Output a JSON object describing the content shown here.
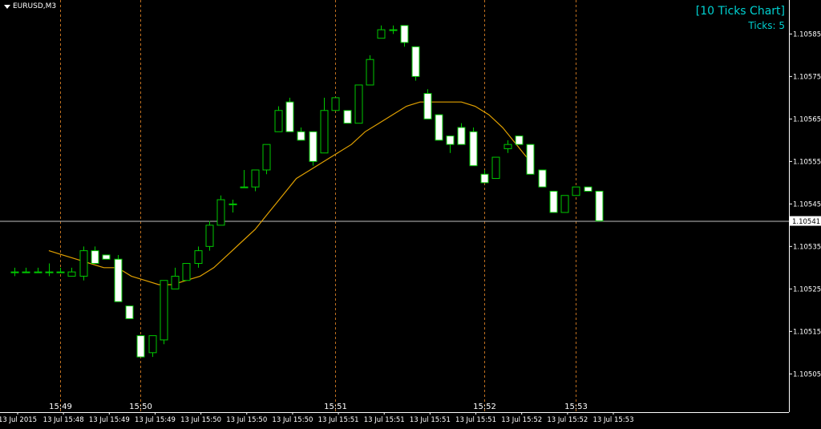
{
  "header": {
    "symbol": "EURUSD,M3",
    "dropdown_icon": "triangle-down-icon"
  },
  "indicator": {
    "title": "[10 Ticks Chart]",
    "ticks_label": "Ticks: 5"
  },
  "colors": {
    "background": "#000000",
    "bull_fill": "#000000",
    "bull_stroke": "#00c800",
    "bear_fill": "#ffffff",
    "bear_stroke": "#00c800",
    "ma_line": "#e0a000",
    "grid": "#c07020",
    "axis": "#ffffff",
    "info_text": "#00d0d0"
  },
  "chart_data": {
    "type": "candlestick",
    "title": "",
    "ylim": [
      1.10496,
      1.10593
    ],
    "y_ticks": [
      "1.10585",
      "1.10575",
      "1.10565",
      "1.10555",
      "1.10545",
      "1.10535",
      "1.10525",
      "1.10515",
      "1.10505"
    ],
    "current_price": "1.10541",
    "x_major_labels": [
      "15:49",
      "15:50",
      "15:51",
      "15:52",
      "15:53"
    ],
    "x_date_labels": [
      "13 Jul 2015",
      "13 Jul 15:48",
      "13 Jul 15:49",
      "13 Jul 15:49",
      "13 Jul 15:50",
      "13 Jul 15:50",
      "13 Jul 15:50",
      "13 Jul 15:51",
      "13 Jul 15:51",
      "13 Jul 15:51",
      "13 Jul 15:51",
      "13 Jul 15:52",
      "13 Jul 15:52",
      "13 Jul 15:53"
    ],
    "candles": [
      {
        "o": 1.10529,
        "h": 1.1053,
        "l": 1.10528,
        "c": 1.10529
      },
      {
        "o": 1.10529,
        "h": 1.1053,
        "l": 1.10529,
        "c": 1.10529
      },
      {
        "o": 1.10529,
        "h": 1.1053,
        "l": 1.10529,
        "c": 1.10529
      },
      {
        "o": 1.10529,
        "h": 1.10531,
        "l": 1.10528,
        "c": 1.10529
      },
      {
        "o": 1.10529,
        "h": 1.1053,
        "l": 1.10529,
        "c": 1.10529
      },
      {
        "o": 1.10528,
        "h": 1.1053,
        "l": 1.10528,
        "c": 1.10529
      },
      {
        "o": 1.10528,
        "h": 1.10535,
        "l": 1.10527,
        "c": 1.10534
      },
      {
        "o": 1.10534,
        "h": 1.10535,
        "l": 1.10531,
        "c": 1.10531
      },
      {
        "o": 1.10533,
        "h": 1.10533,
        "l": 1.10532,
        "c": 1.10532
      },
      {
        "o": 1.10532,
        "h": 1.10533,
        "l": 1.10522,
        "c": 1.10522
      },
      {
        "o": 1.10521,
        "h": 1.10521,
        "l": 1.10518,
        "c": 1.10518
      },
      {
        "o": 1.10514,
        "h": 1.10514,
        "l": 1.10509,
        "c": 1.10509
      },
      {
        "o": 1.1051,
        "h": 1.10514,
        "l": 1.10509,
        "c": 1.10514
      },
      {
        "o": 1.10513,
        "h": 1.10527,
        "l": 1.10512,
        "c": 1.10527
      },
      {
        "o": 1.10525,
        "h": 1.1053,
        "l": 1.10525,
        "c": 1.10528
      },
      {
        "o": 1.10527,
        "h": 1.10531,
        "l": 1.10527,
        "c": 1.10531
      },
      {
        "o": 1.10531,
        "h": 1.10535,
        "l": 1.1053,
        "c": 1.10534
      },
      {
        "o": 1.10535,
        "h": 1.10541,
        "l": 1.10534,
        "c": 1.1054
      },
      {
        "o": 1.1054,
        "h": 1.10547,
        "l": 1.1054,
        "c": 1.10546
      },
      {
        "o": 1.10545,
        "h": 1.10546,
        "l": 1.10543,
        "c": 1.10545
      },
      {
        "o": 1.10549,
        "h": 1.10553,
        "l": 1.10549,
        "c": 1.10549
      },
      {
        "o": 1.10549,
        "h": 1.10553,
        "l": 1.10548,
        "c": 1.10553
      },
      {
        "o": 1.10553,
        "h": 1.10559,
        "l": 1.10552,
        "c": 1.10559
      },
      {
        "o": 1.10562,
        "h": 1.10568,
        "l": 1.10562,
        "c": 1.10567
      },
      {
        "o": 1.10569,
        "h": 1.1057,
        "l": 1.10562,
        "c": 1.10562
      },
      {
        "o": 1.10562,
        "h": 1.10563,
        "l": 1.1056,
        "c": 1.1056
      },
      {
        "o": 1.10562,
        "h": 1.10562,
        "l": 1.10554,
        "c": 1.10555
      },
      {
        "o": 1.10557,
        "h": 1.1057,
        "l": 1.10557,
        "c": 1.10567
      },
      {
        "o": 1.10567,
        "h": 1.1057,
        "l": 1.10567,
        "c": 1.1057
      },
      {
        "o": 1.10567,
        "h": 1.10567,
        "l": 1.10564,
        "c": 1.10564
      },
      {
        "o": 1.10564,
        "h": 1.10573,
        "l": 1.10564,
        "c": 1.10573
      },
      {
        "o": 1.10573,
        "h": 1.1058,
        "l": 1.10573,
        "c": 1.10579
      },
      {
        "o": 1.10584,
        "h": 1.10587,
        "l": 1.10584,
        "c": 1.10586
      },
      {
        "o": 1.10586,
        "h": 1.10587,
        "l": 1.10585,
        "c": 1.10586
      },
      {
        "o": 1.10587,
        "h": 1.10587,
        "l": 1.10582,
        "c": 1.10583
      },
      {
        "o": 1.10582,
        "h": 1.10582,
        "l": 1.10574,
        "c": 1.10575
      },
      {
        "o": 1.10571,
        "h": 1.10572,
        "l": 1.10565,
        "c": 1.10565
      },
      {
        "o": 1.10566,
        "h": 1.10566,
        "l": 1.1056,
        "c": 1.1056
      },
      {
        "o": 1.10561,
        "h": 1.10561,
        "l": 1.10557,
        "c": 1.10559
      },
      {
        "o": 1.10563,
        "h": 1.10564,
        "l": 1.10559,
        "c": 1.10559
      },
      {
        "o": 1.10562,
        "h": 1.10563,
        "l": 1.10554,
        "c": 1.10554
      },
      {
        "o": 1.10552,
        "h": 1.10553,
        "l": 1.1055,
        "c": 1.1055
      },
      {
        "o": 1.10551,
        "h": 1.10556,
        "l": 1.10551,
        "c": 1.10556
      },
      {
        "o": 1.10558,
        "h": 1.1056,
        "l": 1.10557,
        "c": 1.10559
      },
      {
        "o": 1.10561,
        "h": 1.10561,
        "l": 1.10559,
        "c": 1.10559
      },
      {
        "o": 1.10559,
        "h": 1.10559,
        "l": 1.10552,
        "c": 1.10552
      },
      {
        "o": 1.10553,
        "h": 1.10553,
        "l": 1.10549,
        "c": 1.10549
      },
      {
        "o": 1.10548,
        "h": 1.10548,
        "l": 1.10543,
        "c": 1.10543
      },
      {
        "o": 1.10543,
        "h": 1.10547,
        "l": 1.10543,
        "c": 1.10547
      },
      {
        "o": 1.10547,
        "h": 1.10549,
        "l": 1.10547,
        "c": 1.10549
      },
      {
        "o": 1.10549,
        "h": 1.10549,
        "l": 1.10548,
        "c": 1.10548
      },
      {
        "o": 1.10548,
        "h": 1.10548,
        "l": 1.10541,
        "c": 1.10541
      }
    ],
    "moving_average": [
      1.10534,
      1.10533,
      1.10532,
      1.10531,
      1.1053,
      1.1053,
      1.10528,
      1.10527,
      1.10526,
      1.10526,
      1.10527,
      1.10528,
      1.1053,
      1.10533,
      1.10536,
      1.10539,
      1.10543,
      1.10547,
      1.10551,
      1.10553,
      1.10555,
      1.10557,
      1.10559,
      1.10562,
      1.10564,
      1.10566,
      1.10568,
      1.10569,
      1.10569,
      1.10569,
      1.10569,
      1.10568,
      1.10566,
      1.10563,
      1.10559,
      1.10555
    ],
    "ma_start_index": 3,
    "ma_step": 1.2
  }
}
